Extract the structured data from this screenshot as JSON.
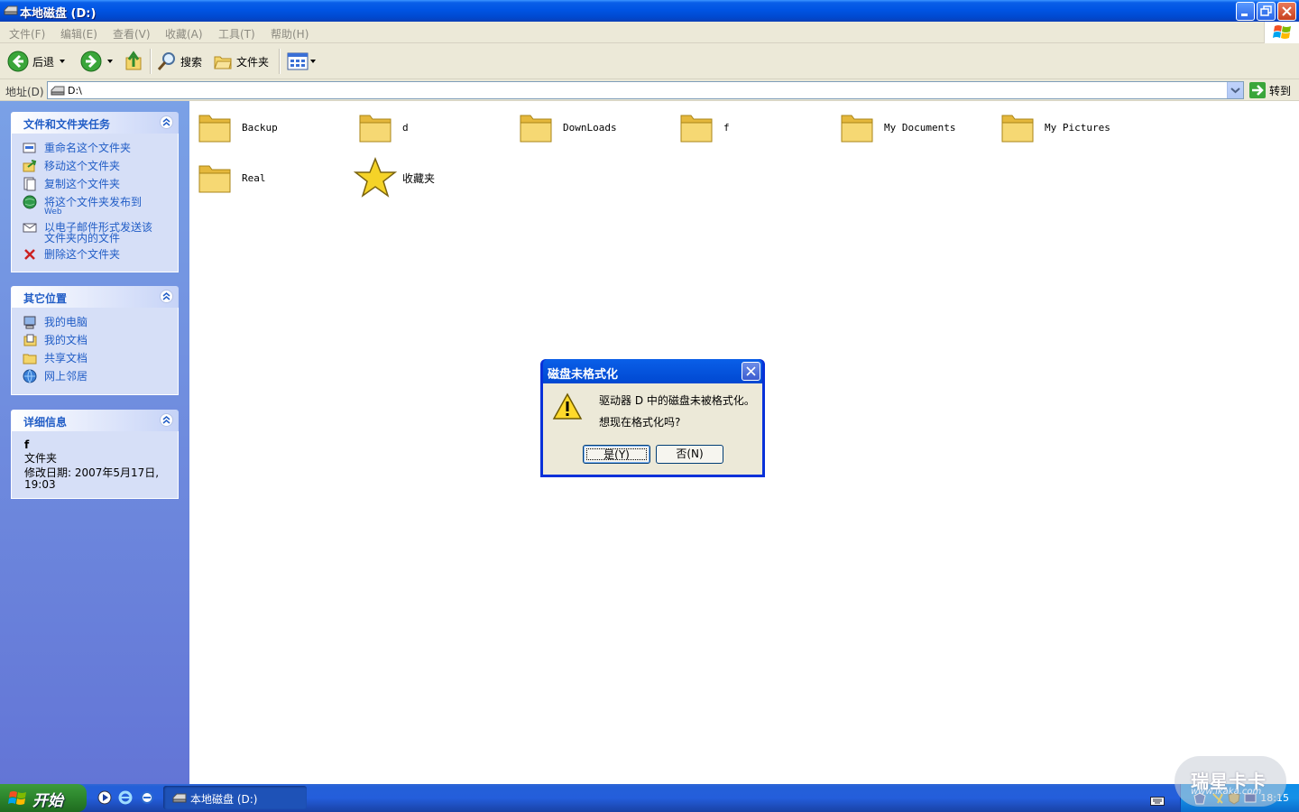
{
  "window": {
    "title": "本地磁盘  (D:)"
  },
  "menu": [
    "文件(F)",
    "编辑(E)",
    "查看(V)",
    "收藏(A)",
    "工具(T)",
    "帮助(H)"
  ],
  "toolbar": {
    "back_label": "后退",
    "search_label": "搜索",
    "folders_label": "文件夹"
  },
  "address": {
    "label": "地址(D)",
    "value": "D:\\",
    "go_label": "转到"
  },
  "panels": {
    "tasks": {
      "title": "文件和文件夹任务",
      "items": [
        {
          "label": "重命名这个文件夹",
          "icon": "rename-icon"
        },
        {
          "label": "移动这个文件夹",
          "icon": "move-icon"
        },
        {
          "label": "复制这个文件夹",
          "icon": "copy-icon"
        },
        {
          "label": "将这个文件夹发布到",
          "sub": "Web",
          "icon": "publish-web-icon"
        },
        {
          "label": "以电子邮件形式发送该",
          "label2": "文件夹内的文件",
          "icon": "email-icon"
        },
        {
          "label": "删除这个文件夹",
          "icon": "delete-icon"
        }
      ]
    },
    "places": {
      "title": "其它位置",
      "items": [
        {
          "label": "我的电脑",
          "icon": "my-computer-icon"
        },
        {
          "label": "我的文档",
          "icon": "my-documents-icon"
        },
        {
          "label": "共享文档",
          "icon": "shared-documents-icon"
        },
        {
          "label": "网上邻居",
          "icon": "network-places-icon"
        }
      ]
    },
    "details": {
      "title": "详细信息",
      "name": "f",
      "type": "文件夹",
      "modified": "修改日期: 2007年5月17日,",
      "modified_time": "19:03"
    }
  },
  "files": [
    {
      "name": "Backup",
      "icon": "folder-icon"
    },
    {
      "name": "d",
      "icon": "folder-icon"
    },
    {
      "name": "DownLoads",
      "icon": "folder-icon"
    },
    {
      "name": "f",
      "icon": "folder-icon"
    },
    {
      "name": "My Documents",
      "icon": "folder-icon"
    },
    {
      "name": "My Pictures",
      "icon": "folder-icon"
    },
    {
      "name": "Real",
      "icon": "folder-icon"
    },
    {
      "name": "收藏夹",
      "icon": "favorites-star-icon"
    }
  ],
  "dialog": {
    "title": "磁盘未格式化",
    "line1": "驱动器 D 中的磁盘未被格式化。",
    "line2": "想现在格式化吗?",
    "yes_label": "是(Y)",
    "no_label": "否(N)"
  },
  "taskbar": {
    "start_label": "开始",
    "window_button": "本地磁盘  (D:)",
    "clock": "18:15"
  },
  "watermark": {
    "text": "瑞星卡卡",
    "url": "www.ikaka.com"
  },
  "colors": {
    "title_blue": "#0054e3",
    "link_blue": "#215dc6",
    "panel_bg": "#d6dff7",
    "folder_yellow": "#f3d56a"
  }
}
